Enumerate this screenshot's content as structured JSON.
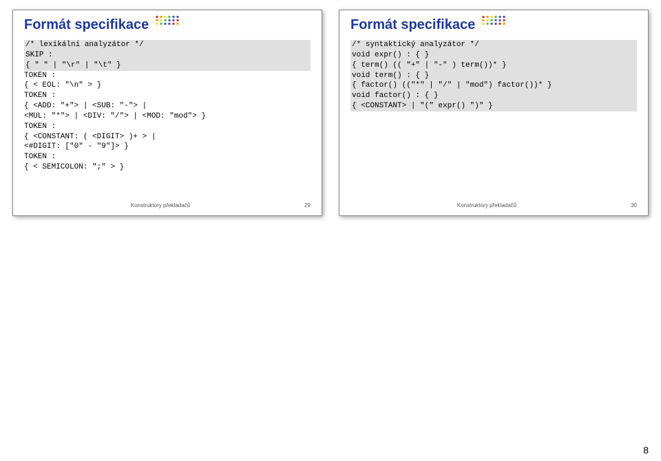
{
  "left": {
    "title": "Formát specifikace",
    "code": {
      "l1": "/* lexikální analyzátor */",
      "l2": "SKIP :",
      "l3": "{ \" \" | \"\\r\" | \"\\t\" }",
      "l4": "TOKEN :",
      "l5": "{ < EOL: \"\\n\" > }",
      "l6": "TOKEN :",
      "l7": "{  <ADD: \"+\"> | <SUB: \"-\"> |",
      "l8": "   <MUL: \"*\"> | <DIV: \"/\"> | <MOD: \"mod\"> }",
      "l9": "TOKEN :",
      "l10": "{  <CONSTANT: ( <DIGIT> )+ > |",
      "l11": "   <#DIGIT: [\"0\" - \"9\"]> }",
      "l12": "TOKEN :",
      "l13": "{  < SEMICOLON: \";\" > }"
    },
    "footer_label": "Konstruktory překladačů",
    "footer_num": "29"
  },
  "right": {
    "title": "Formát specifikace",
    "code": {
      "r1": "/* syntaktický analyzátor */",
      "r2": "void expr() : { }",
      "r3": "{ term() (( \"+\" | \"-\" ) term())* }",
      "r4": "void term() : { }",
      "r5": "{ factor() ((\"*\" | \"/\" | \"mod\") factor())* }",
      "r6": "void factor() : { }",
      "r7": "{ <CONSTANT>  | \"(\" expr() \")\" }"
    },
    "footer_label": "Konstruktory překladačů",
    "footer_num": "30"
  },
  "page_number": "8"
}
